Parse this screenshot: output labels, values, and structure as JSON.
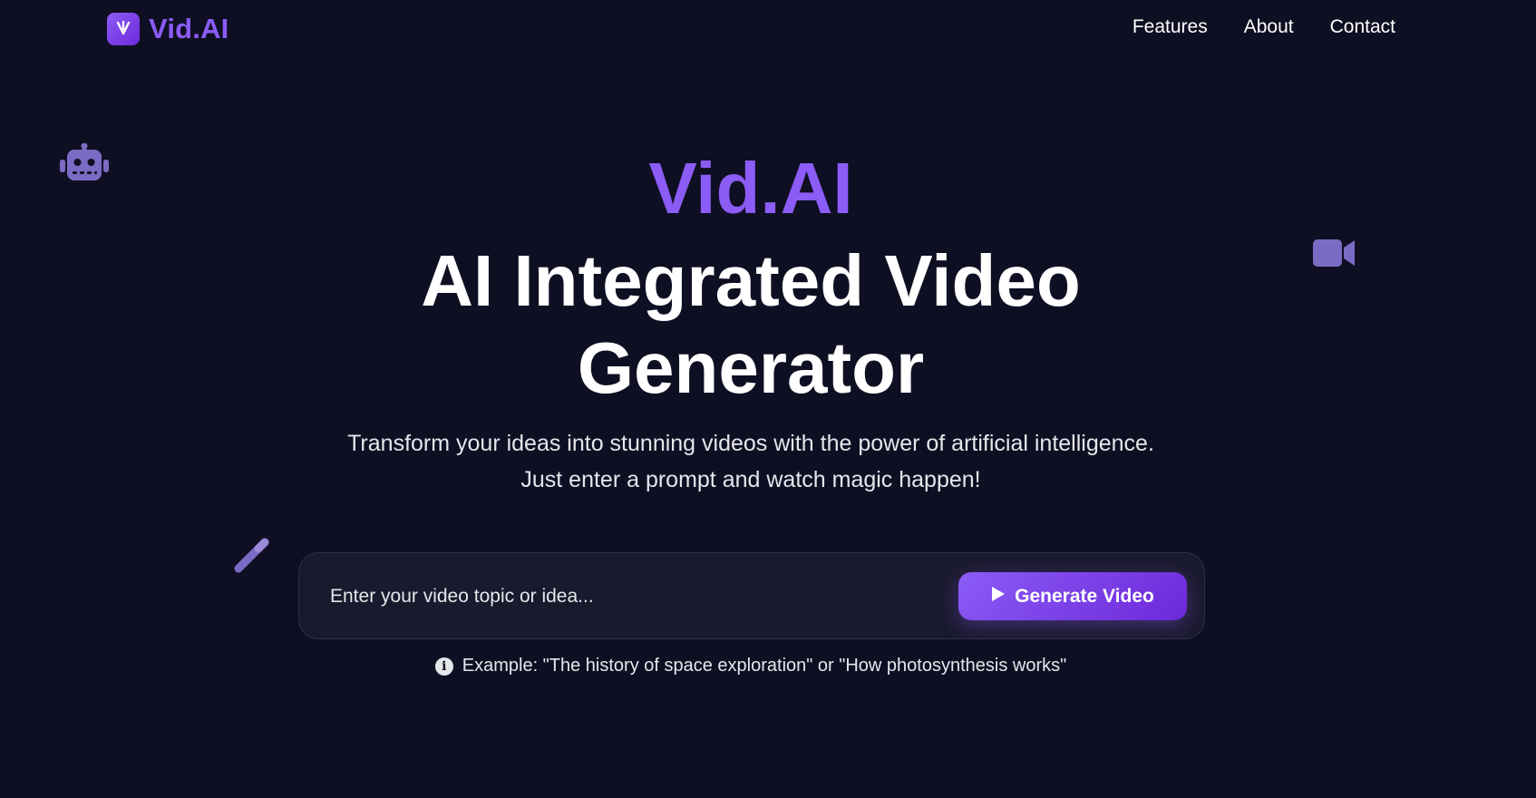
{
  "nav": {
    "brand": "Vid.AI",
    "links": [
      {
        "label": "Features"
      },
      {
        "label": "About"
      },
      {
        "label": "Contact"
      }
    ]
  },
  "hero": {
    "brand": "Vid.AI",
    "title_line1": "AI Integrated Video",
    "title_line2": "Generator",
    "subtitle_line1": "Transform your ideas into stunning videos with the power of artificial intelligence.",
    "subtitle_line2": "Just enter a prompt and watch magic happen!"
  },
  "prompt": {
    "placeholder": "Enter your video topic or idea...",
    "button_label": "Generate Video"
  },
  "hint": {
    "text": "Example: \"The history of space exploration\" or \"How photosynthesis works\""
  },
  "decorations": [
    "robot-icon",
    "video-camera-icon",
    "magic-wand-icon"
  ],
  "colors": {
    "background": "#0f0f23",
    "accent": "#8b5cf6",
    "accent_dark": "#6d28d9",
    "card": "#1a1a2e"
  }
}
